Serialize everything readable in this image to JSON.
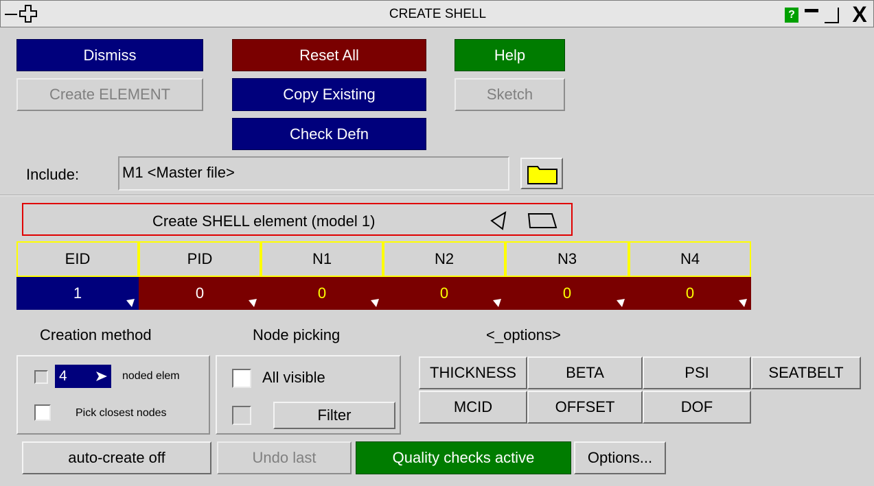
{
  "window": {
    "title": "CREATE SHELL",
    "left_icons": [
      "minimize-dash-icon",
      "move-cross-icon"
    ],
    "right_icons": [
      "help-icon",
      "minimize-icon",
      "restore-icon",
      "close-icon"
    ],
    "help_glyph": "?",
    "close_glyph": "X"
  },
  "top_buttons": {
    "dismiss": "Dismiss",
    "reset_all": "Reset All",
    "help": "Help",
    "create_element": "Create ELEMENT",
    "copy_existing": "Copy Existing",
    "sketch": "Sketch",
    "check_defn": "Check Defn"
  },
  "include": {
    "label": "Include:",
    "value": "M1  <Master file>",
    "folder_icon": "folder-icon"
  },
  "element_header": {
    "text": "Create SHELL element (model 1)",
    "icons": [
      "triangle-shape-icon",
      "quad-shape-icon"
    ]
  },
  "fields": {
    "headers": [
      "EID",
      "PID",
      "N1",
      "N2",
      "N3",
      "N4"
    ],
    "values": [
      "1",
      "0",
      "0",
      "0",
      "0",
      "0"
    ]
  },
  "sections": {
    "creation_method": "Creation method",
    "node_picking": "Node picking",
    "options": "<_options>"
  },
  "creation": {
    "nodes_value": "4",
    "noded_label": "noded elem",
    "pick_closest": "Pick closest nodes"
  },
  "node_picking": {
    "all_visible": "All visible",
    "filter": "Filter"
  },
  "option_buttons": {
    "row1": [
      "THICKNESS",
      "BETA",
      "PSI",
      "SEATBELT"
    ],
    "row2": [
      "MCID",
      "OFFSET",
      "DOF"
    ]
  },
  "bottom": {
    "auto_create": "auto-create off",
    "undo_last": "Undo last",
    "quality": "Quality checks active",
    "options": "Options..."
  },
  "colors": {
    "blue": "#00007c",
    "red": "#7a0000",
    "green": "#007c00",
    "yellow_text": "#ffff00",
    "highlight_border": "#e00000"
  }
}
